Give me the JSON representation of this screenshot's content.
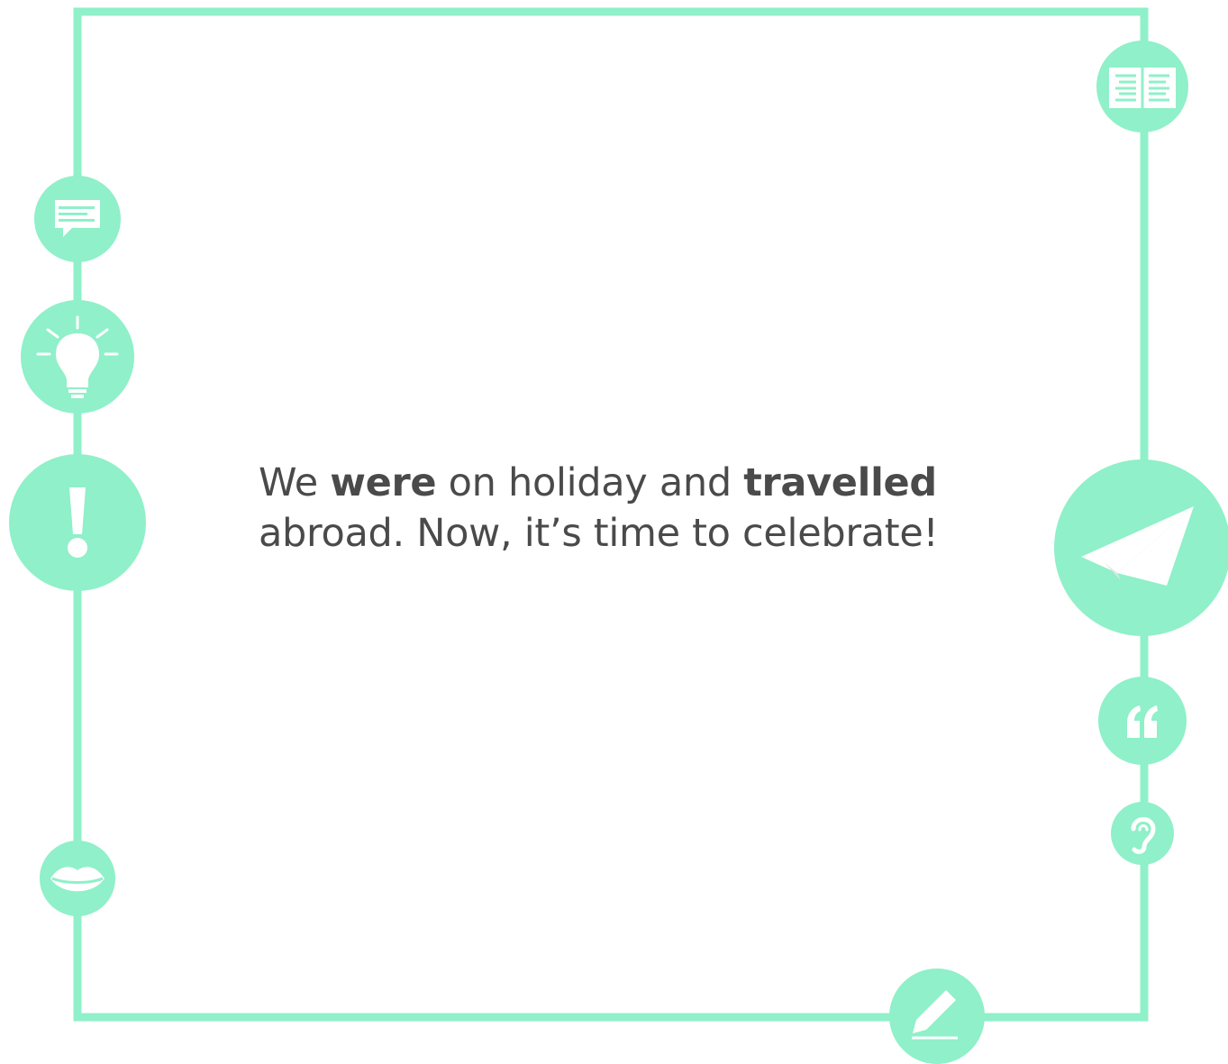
{
  "theme": {
    "accent": "#8ff0c9",
    "text_color": "#4a4a4a",
    "icon_fill": "#ffffff",
    "plane_shadow": "#e4e4e4",
    "background": "#ffffff"
  },
  "sentence": {
    "line1": {
      "w1": "We",
      "w2": "were",
      "w3": "on holiday and",
      "w4": "travelled"
    },
    "line2": "abroad. Now, it’s time to celebrate!"
  },
  "icons": [
    "speech-bubble-icon",
    "lightbulb-icon",
    "exclamation-icon",
    "lips-icon",
    "newspaper-icon",
    "paper-plane-icon",
    "quote-icon",
    "ear-icon",
    "pencil-icon"
  ]
}
